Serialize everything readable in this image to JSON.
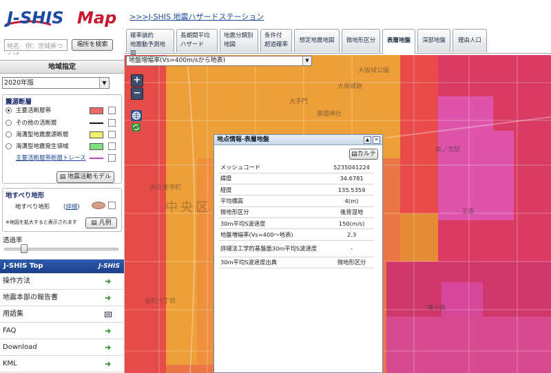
{
  "header": {
    "logo_text": "J-SHIS Map",
    "site_link": ">>>J-SHIS 地震ハザードステーション",
    "search_placeholder": "地名　例：茨城県つくば",
    "search_button": "場所を検索"
  },
  "tabs": [
    {
      "line1": "確率論的",
      "line2": "地震動予測地図"
    },
    {
      "line1": "長期間平均",
      "line2": "ハザード"
    },
    {
      "line1": "地震分類別",
      "line2": "地図"
    },
    {
      "line1": "条件付",
      "line2": "超過確率"
    },
    {
      "line1": "想定地震地図",
      "line2": ""
    },
    {
      "line1": "微地形区分",
      "line2": ""
    },
    {
      "line1": "表層地盤",
      "line2": "",
      "active": true
    },
    {
      "line1": "深部地盤",
      "line2": ""
    },
    {
      "line1": "理由人口",
      "line2": ""
    }
  ],
  "sidebar": {
    "region_header": "地域指定",
    "year_select": "2020年版",
    "sources_title": "震源断層",
    "sources": [
      {
        "label": "主要活断層帯",
        "color": "#e86a6a",
        "kind": "box",
        "selected": true
      },
      {
        "label": "その他の活断層",
        "color": "#111111",
        "kind": "line",
        "selected": false
      },
      {
        "label": "海溝型地震震源断層",
        "color": "#f0f070",
        "kind": "box",
        "selected": false
      },
      {
        "label": "海溝型地震発生領域",
        "color": "#7de07d",
        "kind": "box",
        "selected": false
      },
      {
        "label": "主要活断層帯断層トレース",
        "color": "#c040c0",
        "kind": "line",
        "selected": false,
        "link": true
      }
    ],
    "model_button": "地震活動モデル",
    "landslide_title": "地すべり地形",
    "landslide_label": "地すべり地形",
    "landslide_detail": "詳細",
    "landslide_color": "#d6a088",
    "zoom_note": "※地図を拡大すると表示されます",
    "legend_button": "凡例",
    "opacity_label": "透過率",
    "jshis_top": "J-SHIS Top",
    "jshis_mini": "J-SHIS",
    "nav": [
      "操作方法",
      "地震本部の報告書",
      "用語集",
      "FAQ",
      "Download",
      "KML"
    ]
  },
  "map": {
    "layer_select": "地盤増幅率(Vs=400m/sから地表)",
    "zoom_in": "+",
    "zoom_out": "−",
    "labels": [
      "大阪城公園",
      "大坂城跡",
      "豊國神社",
      "大手門",
      "中央区",
      "内久宝寺町",
      "森ノ宮駅",
      "玉造",
      "東小橋",
      "谷町六丁目"
    ]
  },
  "popup": {
    "title": "地点情報-表層地盤",
    "karte_button": "カルテ",
    "rows": [
      {
        "label": "メッシュコード",
        "value": "5235041224"
      },
      {
        "label": "緯度",
        "value": "34.6781"
      },
      {
        "label": "経度",
        "value": "135.5359"
      },
      {
        "label": "平均標高",
        "value": "4(m)"
      },
      {
        "label": "微地形区分",
        "value": "後背湿地"
      },
      {
        "label": "30m平均S波速度",
        "value": "150(m/s)"
      },
      {
        "label": "地盤増幅率(Vs=400～地表)",
        "value": "2.3"
      },
      {
        "label": "詳細法工学的基盤面30m平均S波速度",
        "value": "-"
      },
      {
        "label": "30m平均S波速度出典",
        "value": "微地形区分"
      }
    ]
  }
}
